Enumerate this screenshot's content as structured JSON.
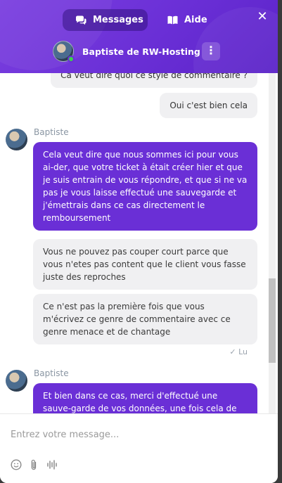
{
  "header": {
    "tabs": [
      {
        "label": "Messages",
        "icon": "chat-bubbles-icon",
        "active": true
      },
      {
        "label": "Aide",
        "icon": "book-icon",
        "active": false
      }
    ],
    "close_icon": "✕",
    "agent_name": "Baptiste de RW-Hosting",
    "more_icon": "⋮"
  },
  "messages": [
    {
      "from": "user",
      "text": "Ca veut dire quoi ce style de commentaire ?"
    },
    {
      "from": "user",
      "text": "Oui c'est bien cela"
    },
    {
      "from": "agent",
      "sender": "Baptiste",
      "text": "Cela veut dire que nous sommes ici pour vous ai-der, que votre ticket à était créer hier et que je suis entrain de vous répondre, et que si ne va pas je vous laisse effectué une sauvegarde et j'émettrais dans ce cas directement le remboursement"
    },
    {
      "from": "user_left",
      "text": "Vous ne pouvez pas couper court parce que vous n'etes pas content que le client vous fasse juste des reproches"
    },
    {
      "from": "user_left",
      "text": "Ce n'est pas la première fois que vous m'écrivez ce genre de commentaire avec ce genre menace et de chantage"
    },
    {
      "from": "status",
      "text": "✓ Lu"
    },
    {
      "from": "agent",
      "sender": "Baptiste",
      "text": "Et bien dans ce cas, merci d'effectué une sauve-garde de vos données, une fois cela de fait, nous"
    }
  ],
  "composer": {
    "placeholder": "Entrez votre message...",
    "tools": [
      "emoji-icon",
      "attachment-icon",
      "voice-icon"
    ]
  },
  "colors": {
    "brand": "#6a2fd6",
    "user_bubble": "#f0f0f2"
  }
}
